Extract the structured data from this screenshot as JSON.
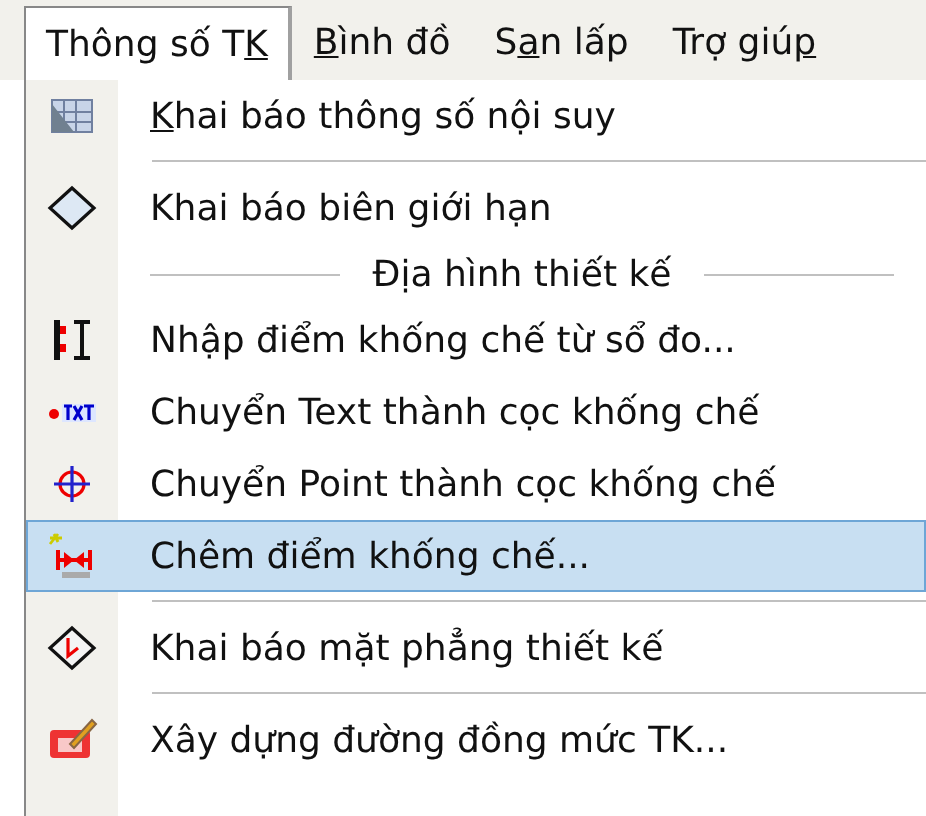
{
  "menubar": [
    {
      "label": {
        "before": "Thông số T",
        "key": "K"
      },
      "selected": true
    },
    {
      "label": {
        "key": "B",
        "after": "ình đồ"
      },
      "selected": false
    },
    {
      "label": {
        "before": "S",
        "key": "a",
        "after": "n lấp"
      },
      "selected": false
    },
    {
      "label": {
        "before": "Trợ giú",
        "key": "p"
      },
      "selected": false
    }
  ],
  "menu": [
    {
      "kind": "item",
      "label": {
        "key": "K",
        "after": "hai báo thông số nội suy"
      },
      "selected": false
    },
    {
      "kind": "separator"
    },
    {
      "kind": "item",
      "label": {
        "before": "Khai báo biên giới hạn"
      },
      "selected": false
    },
    {
      "kind": "header",
      "label": "Địa hình thiết kế"
    },
    {
      "kind": "item",
      "label": {
        "before": "Nhập điểm khống chế từ sổ đo..."
      },
      "selected": false
    },
    {
      "kind": "item",
      "label": {
        "before": "Chuyển Text thành cọc khống chế"
      },
      "selected": false
    },
    {
      "kind": "item",
      "label": {
        "before": "Chuyển Point thành cọc khống chế"
      },
      "selected": false
    },
    {
      "kind": "item",
      "label": {
        "before": "Chêm điểm khống chế..."
      },
      "selected": true
    },
    {
      "kind": "separator"
    },
    {
      "kind": "item",
      "label": {
        "before": "Khai báo mặt phẳng thiết kế"
      },
      "selected": false
    },
    {
      "kind": "separator"
    },
    {
      "kind": "item",
      "label": {
        "before": "Xây dựng đường đồng mức TK..."
      },
      "selected": false
    }
  ]
}
